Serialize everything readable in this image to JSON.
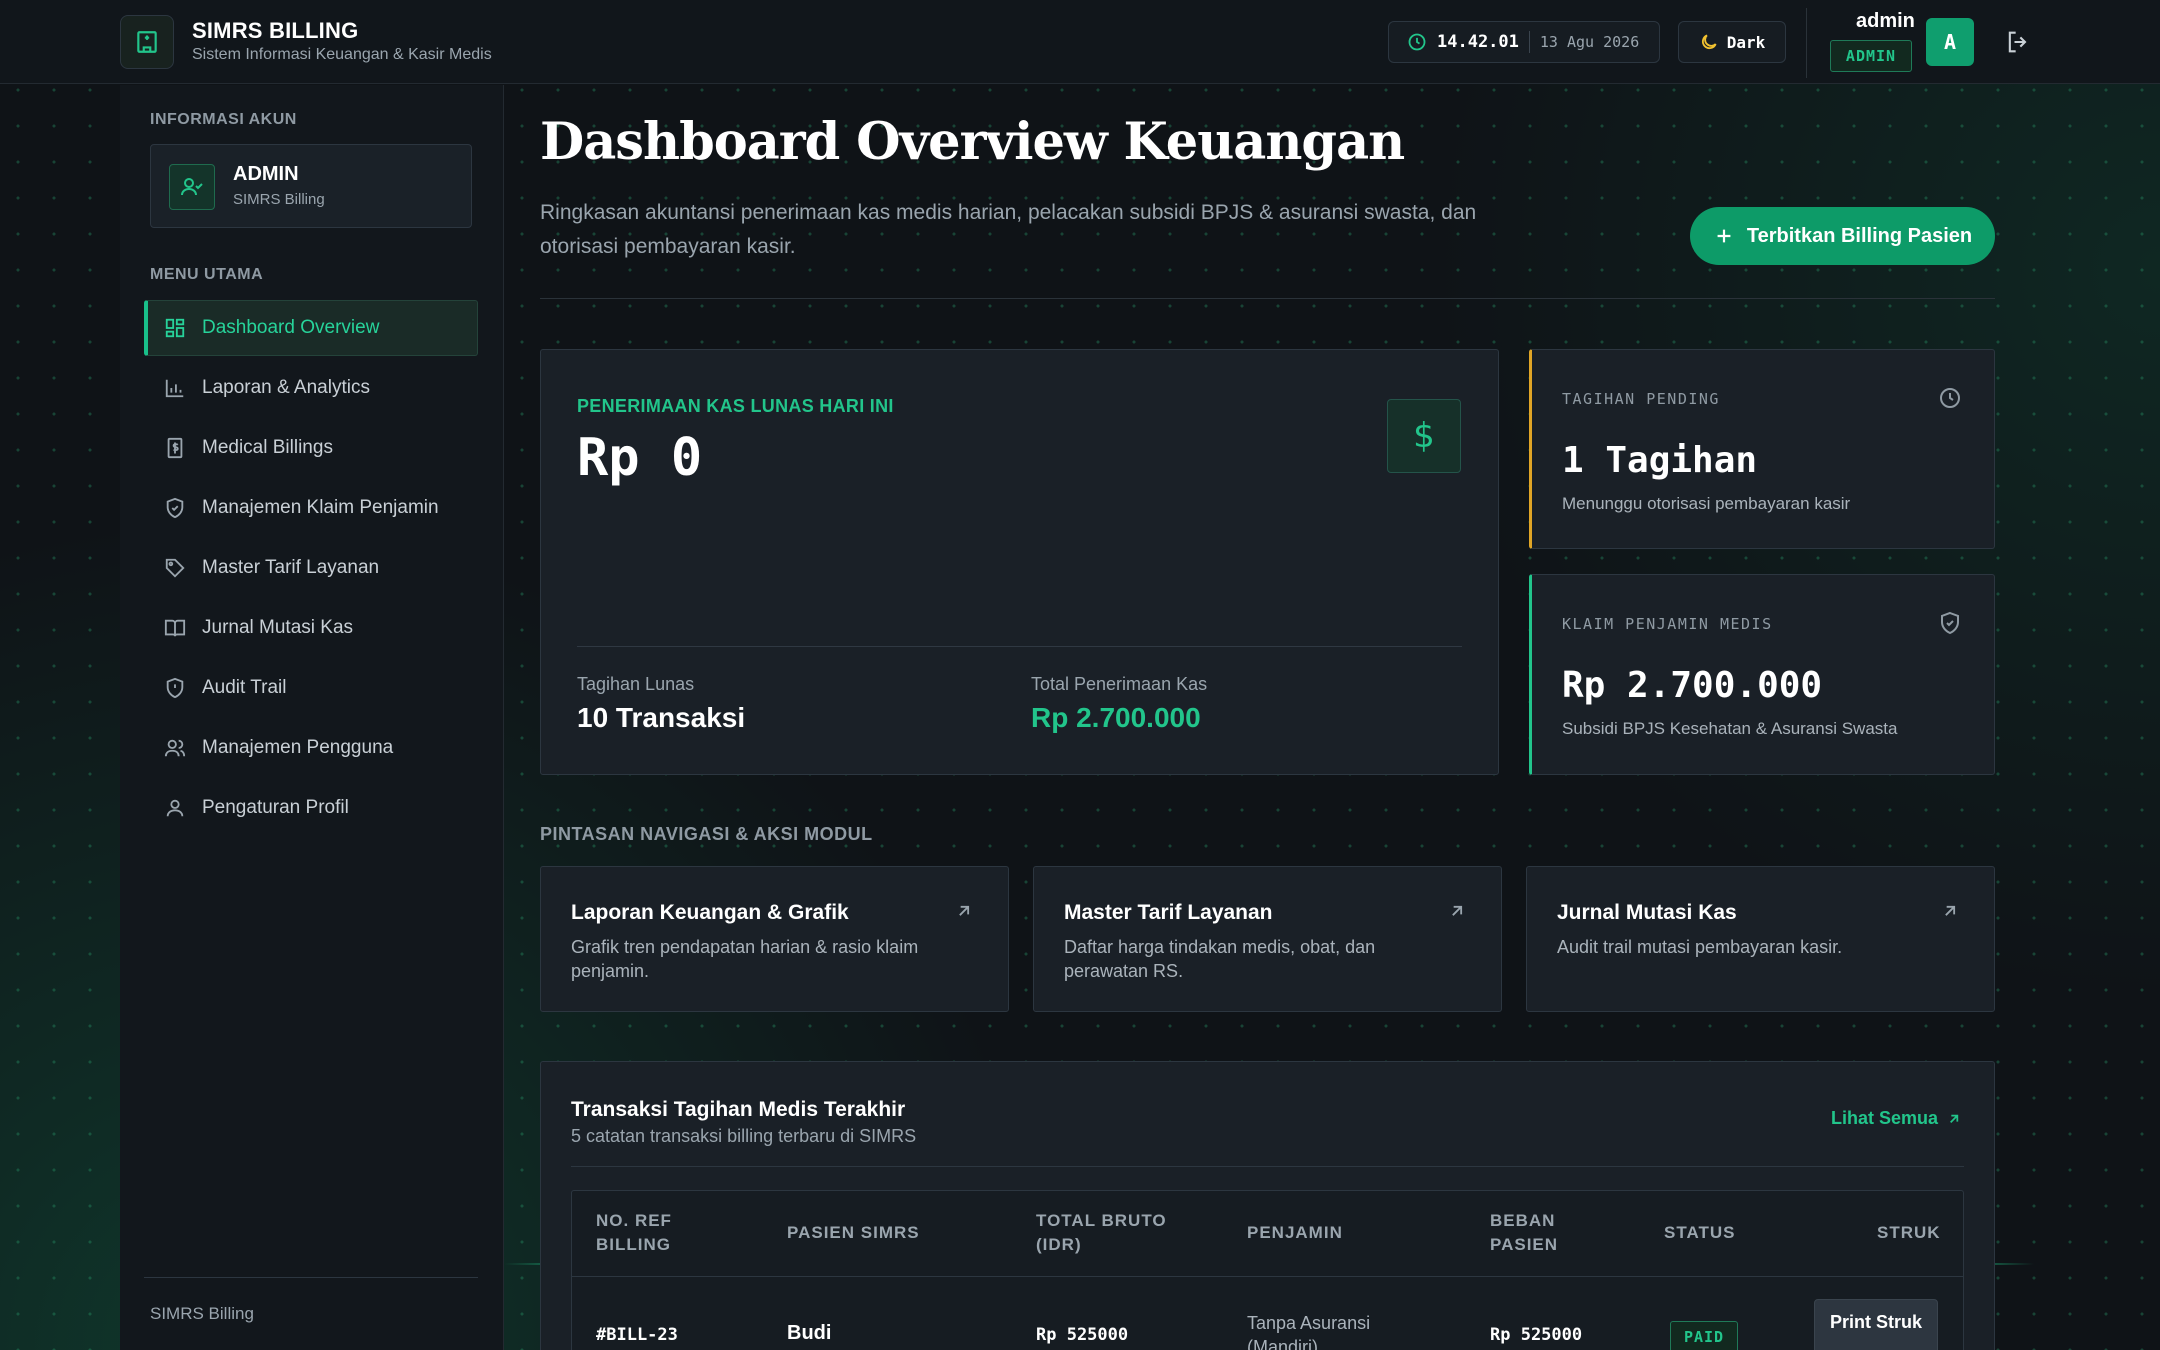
{
  "header": {
    "app_title": "SIMRS BILLING",
    "app_subtitle": "Sistem Informasi Keuangan & Kasir Medis",
    "time": "14.42.01",
    "date": "13 Agu 2026",
    "theme_label": "Dark",
    "user_name": "admin",
    "user_role": "ADMIN",
    "avatar_initial": "A",
    "icons": {
      "brand": "hospital-icon",
      "clock": "clock-icon",
      "theme": "moon-icon",
      "logout": "logout-icon"
    }
  },
  "sidebar": {
    "account_heading": "INFORMASI AKUN",
    "account_name": "ADMIN",
    "account_sub": "SIMRS Billing",
    "menu_heading": "MENU UTAMA",
    "items": [
      {
        "label": "Dashboard Overview",
        "icon": "dashboard-icon",
        "active": true
      },
      {
        "label": "Laporan & Analytics",
        "icon": "bar-chart-icon"
      },
      {
        "label": "Medical Billings",
        "icon": "receipt-icon"
      },
      {
        "label": "Manajemen Klaim Penjamin",
        "icon": "shield-check-icon"
      },
      {
        "label": "Master Tarif Layanan",
        "icon": "tag-icon"
      },
      {
        "label": "Jurnal Mutasi Kas",
        "icon": "book-icon"
      },
      {
        "label": "Audit Trail",
        "icon": "shield-alert-icon"
      },
      {
        "label": "Manajemen Pengguna",
        "icon": "users-icon"
      },
      {
        "label": "Pengaturan Profil",
        "icon": "user-icon"
      }
    ],
    "footer": "SIMRS Billing"
  },
  "main": {
    "title": "Dashboard Overview Keuangan",
    "description": "Ringkasan akuntansi penerimaan kas medis harian, pelacakan subsidi BPJS & asuransi swasta, dan otorisasi pembayaran kasir.",
    "primary_button": "Terbitkan Billing Pasien",
    "cash_card": {
      "label": "PENERIMAAN KAS LUNAS HARI INI",
      "value": "Rp 0",
      "icon_glyph": "$",
      "stat1_label": "Tagihan Lunas",
      "stat1_value": "10 Transaksi",
      "stat2_label": "Total Penerimaan Kas",
      "stat2_value": "Rp 2.700.000"
    },
    "pending_card": {
      "label": "TAGIHAN PENDING",
      "value": "1 Tagihan",
      "sub": "Menunggu otorisasi pembayaran kasir"
    },
    "claim_card": {
      "label": "KLAIM PENJAMIN MEDIS",
      "value": "Rp 2.700.000",
      "sub": "Subsidi BPJS Kesehatan & Asuransi Swasta"
    },
    "shortcuts_heading": "PINTASAN NAVIGASI & AKSI MODUL",
    "shortcuts": [
      {
        "title": "Laporan Keuangan & Grafik",
        "desc": "Grafik tren pendapatan harian & rasio klaim penjamin."
      },
      {
        "title": "Master Tarif Layanan",
        "desc": "Daftar harga tindakan medis, obat, dan perawatan RS."
      },
      {
        "title": "Jurnal Mutasi Kas",
        "desc": "Audit trail mutasi pembayaran kasir."
      }
    ],
    "transactions": {
      "title": "Transaksi Tagihan Medis Terakhir",
      "subtitle": "5 catatan transaksi billing terbaru di SIMRS",
      "view_all": "Lihat Semua",
      "headers": [
        "NO. REF BILLING",
        "PASIEN SIMRS",
        "TOTAL BRUTO (IDR)",
        "PENJAMIN",
        "BEBAN PASIEN",
        "STATUS",
        "STRUK"
      ],
      "rows": [
        {
          "ref": "#BILL-23",
          "patient": "Budi",
          "gross": "Rp 525000",
          "payer": "Tanpa Asuransi (Mandiri)",
          "patient_cost": "Rp 525000",
          "status": "PAID",
          "action": "Print Struk"
        }
      ]
    }
  },
  "colors": {
    "accent": "#22c58b",
    "button": "#0d9b68",
    "pending_border": "#e0a526",
    "bg": "#0f1317"
  }
}
